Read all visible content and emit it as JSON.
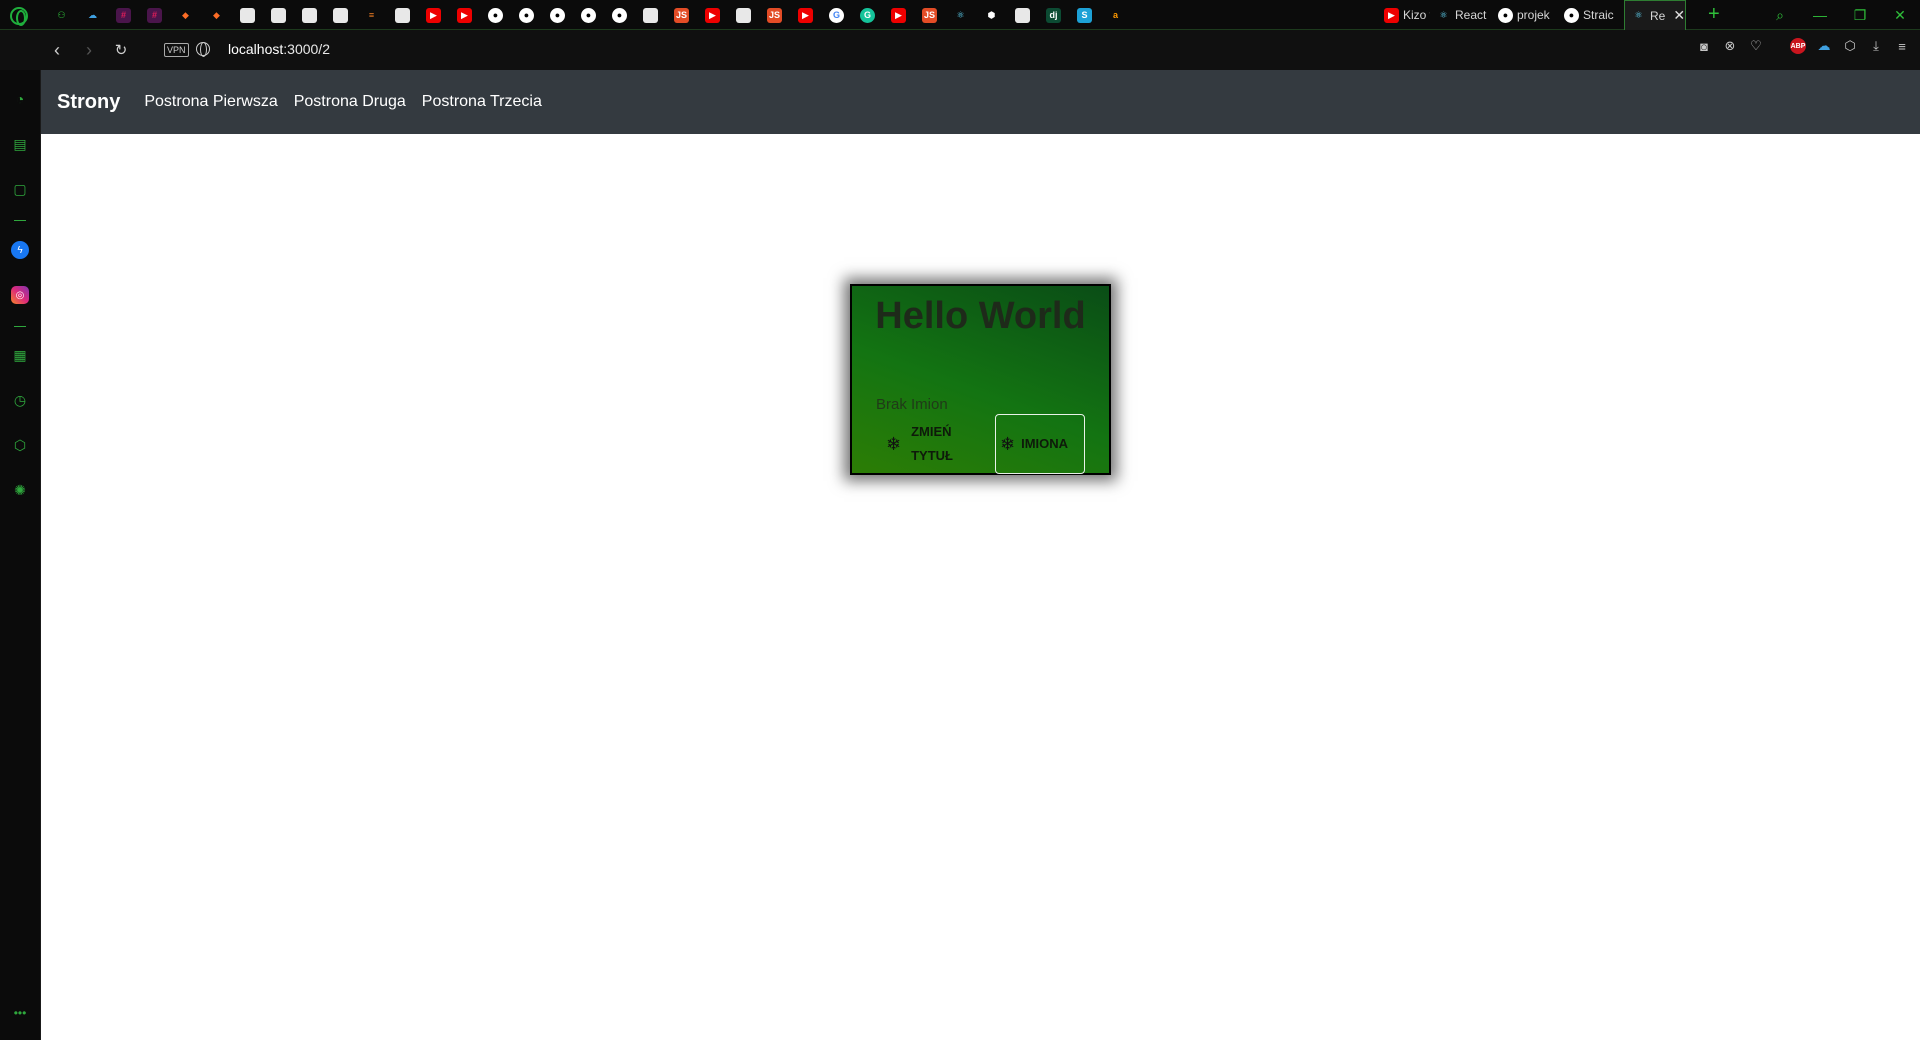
{
  "browser": {
    "titled_tabs": [
      {
        "label": "Kizo fi",
        "icon": "youtube-icon"
      },
      {
        "label": "React",
        "icon": "react-icon"
      },
      {
        "label": "projek",
        "icon": "github-icon"
      },
      {
        "label": "Straic",
        "icon": "github-icon"
      },
      {
        "label": "Re",
        "icon": "react-icon",
        "active": true
      }
    ],
    "pinned_tab_icons": [
      "gamepad-icon",
      "cloud-icon",
      "slack-icon",
      "slack-icon",
      "gitlab-icon",
      "gitlab-icon",
      "file-icon",
      "file-icon",
      "file-icon",
      "file-icon",
      "stackoverflow-icon",
      "file-icon",
      "youtube-icon",
      "youtube-icon",
      "github-icon",
      "github-icon",
      "github-icon",
      "github-icon",
      "github-icon",
      "file-icon",
      "js-icon",
      "youtube-icon",
      "file-icon",
      "js-icon",
      "youtube-icon",
      "google-icon",
      "grammarly-icon",
      "youtube-icon",
      "js-icon",
      "react-icon",
      "nodejs-icon",
      "file-icon",
      "django-icon",
      "s-icon",
      "amazon-icon"
    ],
    "address": {
      "vpn_label": "VPN",
      "url_host": "localhost",
      "url_rest": ":3000/2"
    },
    "toolbar_icons": [
      "camera-icon",
      "close-circle-icon",
      "heart-icon",
      "adblock-icon",
      "cloud-icon",
      "cube-icon",
      "download-icon",
      "menu-icon"
    ],
    "toolbar_abp_label": "ABP",
    "sidebar_icons": [
      "speed-dial-icon",
      "briefcase-icon",
      "twitch-icon",
      "messenger-icon",
      "instagram-icon",
      "grid-icon",
      "clock-icon",
      "cube-icon",
      "gear-icon",
      "more-icon"
    ]
  },
  "app": {
    "brand": "Strony",
    "nav_links": [
      "Postrona Pierwsza",
      "Postrona Druga",
      "Postrona Trzecia"
    ]
  },
  "card": {
    "title": "Hello World",
    "subtitle": "Brak Imion",
    "buttons": [
      {
        "label": "ZMIEŃ TYTUŁ",
        "icon": "snowflake-icon"
      },
      {
        "label": "IMIONA",
        "icon": "snowflake-icon"
      }
    ]
  },
  "colors": {
    "navbar_bg": "#343a40",
    "card_gradient_start": "#0a4d16",
    "card_gradient_end": "#2c7d05",
    "opera_green": "#2fbf3a"
  }
}
